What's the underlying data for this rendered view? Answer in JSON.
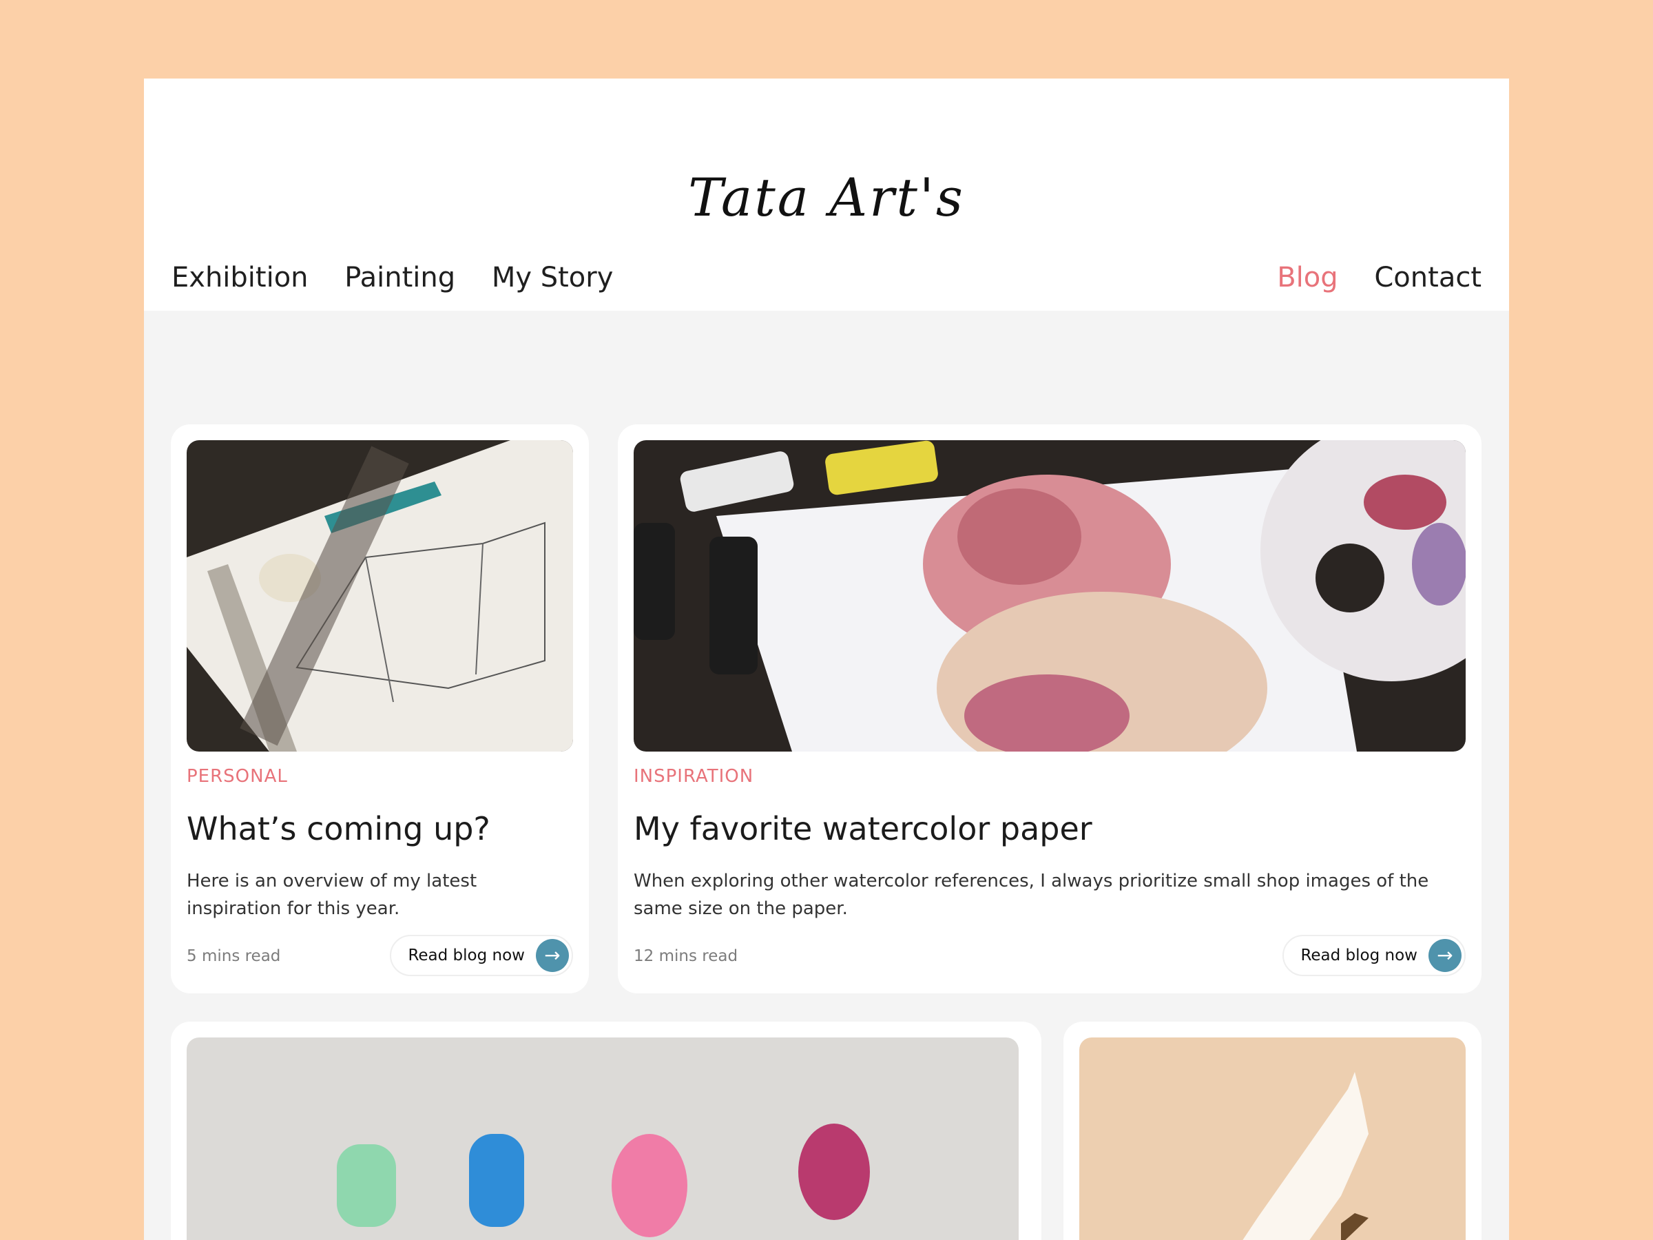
{
  "site": {
    "logo": "Tata Art's"
  },
  "nav": {
    "left": [
      {
        "label": "Exhibition"
      },
      {
        "label": "Painting"
      },
      {
        "label": "My Story"
      }
    ],
    "right": [
      {
        "label": "Blog",
        "active": true
      },
      {
        "label": "Contact"
      }
    ]
  },
  "posts": [
    {
      "category": "PERSONAL",
      "title": "What’s coming up?",
      "excerpt": "Here is an overview of my latest inspiration for this year.",
      "read_time": "5 mins read",
      "cta": "Read blog now"
    },
    {
      "category": "INSPIRATION",
      "title": "My favorite watercolor paper",
      "excerpt": "When exploring other watercolor references, I always prioritize small shop images of the same size on the paper.",
      "read_time": "12 mins read",
      "cta": "Read blog now"
    }
  ],
  "icons": {
    "read_button": "arrow-right-icon"
  },
  "colors": {
    "page_background": "#fcd0a8",
    "accent": "#e8737a",
    "button_circle": "#4f93ac"
  }
}
